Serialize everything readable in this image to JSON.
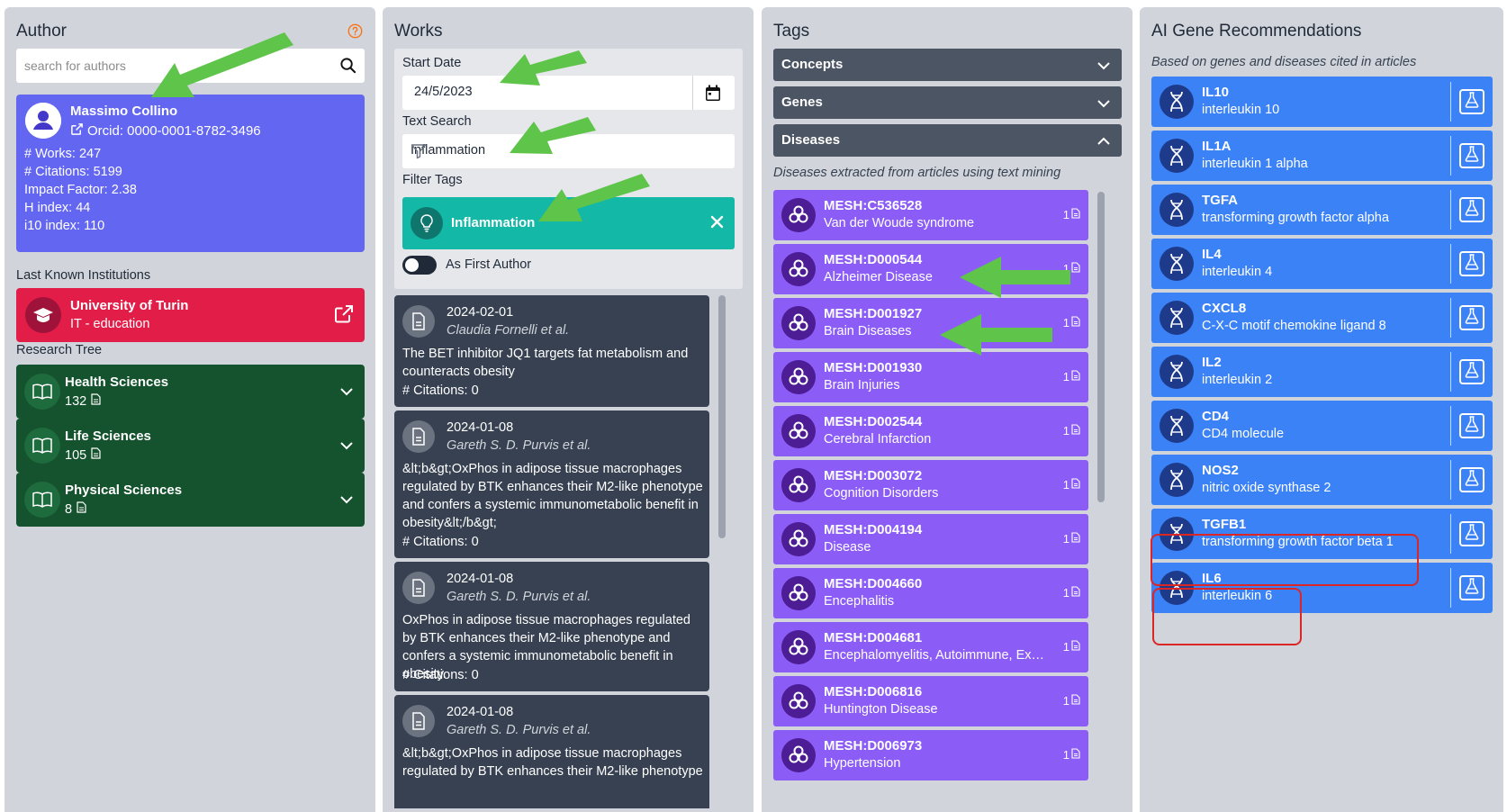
{
  "author_panel": {
    "title": "Author",
    "search_placeholder": "search for authors",
    "author": {
      "name": "Massimo Collino",
      "orcid": "Orcid: 0000-0001-8782-3496",
      "works": "# Works: 247",
      "citations": "# Citations: 5199",
      "impact": "Impact Factor: 2.38",
      "h_index": "H index: 44",
      "i10_index": "i10 index: 110"
    },
    "institutions_label": "Last Known Institutions",
    "institution": {
      "name": "University of Turin",
      "sub": "IT - education"
    },
    "tree_label": "Research Tree",
    "tree": [
      {
        "name": "Health Sciences",
        "count": "132"
      },
      {
        "name": "Life Sciences",
        "count": "105"
      },
      {
        "name": "Physical Sciences",
        "count": "8"
      }
    ]
  },
  "works_panel": {
    "title": "Works",
    "start_date_label": "Start Date",
    "start_date_value": "24/5/2023",
    "text_search_label": "Text Search",
    "text_search_value": "Inflammation",
    "filter_tags_label": "Filter Tags",
    "active_tag": "Inflammation",
    "first_author_label": "As First Author",
    "works": [
      {
        "date": "2024-02-01",
        "authors": "Claudia Fornelli et al.",
        "title": "The BET inhibitor JQ1 targets fat metabolism and counteracts obesity",
        "citations": "# Citations: 0"
      },
      {
        "date": "2024-01-08",
        "authors": "Gareth S. D. Purvis et al.",
        "title": "&lt;b&gt;OxPhos in adipose tissue macrophages regulated by BTK enhances their M2-like phenotype and confers a systemic immunometabolic benefit in obesity&lt;/b&gt;",
        "citations": "# Citations: 0"
      },
      {
        "date": "2024-01-08",
        "authors": "Gareth S. D. Purvis et al.",
        "title": "OxPhos in adipose tissue macrophages regulated by BTK enhances their M2-like phenotype and confers a systemic immunometabolic benefit in obesity.",
        "citations": "# Citations: 0"
      },
      {
        "date": "2024-01-08",
        "authors": "Gareth S. D. Purvis et al.",
        "title": "&lt;b&gt;OxPhos in adipose tissue macrophages regulated by BTK enhances their M2-like phenotype",
        "citations": ""
      }
    ]
  },
  "tags_panel": {
    "title": "Tags",
    "sections": [
      "Concepts",
      "Genes",
      "Diseases"
    ],
    "diseases_note": "Diseases extracted from articles using text mining",
    "diseases": [
      {
        "code": "MESH:C536528",
        "name": "Van der Woude syndrome",
        "count": "1"
      },
      {
        "code": "MESH:D000544",
        "name": "Alzheimer Disease",
        "count": "1"
      },
      {
        "code": "MESH:D001927",
        "name": "Brain Diseases",
        "count": "1"
      },
      {
        "code": "MESH:D001930",
        "name": "Brain Injuries",
        "count": "1"
      },
      {
        "code": "MESH:D002544",
        "name": "Cerebral Infarction",
        "count": "1"
      },
      {
        "code": "MESH:D003072",
        "name": "Cognition Disorders",
        "count": "1"
      },
      {
        "code": "MESH:D004194",
        "name": "Disease",
        "count": "1"
      },
      {
        "code": "MESH:D004660",
        "name": "Encephalitis",
        "count": "1"
      },
      {
        "code": "MESH:D004681",
        "name": "Encephalomyelitis, Autoimmune, Expe...",
        "count": "1"
      },
      {
        "code": "MESH:D006816",
        "name": "Huntington Disease",
        "count": "1"
      },
      {
        "code": "MESH:D006973",
        "name": "Hypertension",
        "count": "1"
      }
    ]
  },
  "genes_panel": {
    "title": "AI Gene Recommendations",
    "subtitle": "Based on genes and diseases cited in articles",
    "genes": [
      {
        "symbol": "IL10",
        "name": "interleukin 10"
      },
      {
        "symbol": "IL1A",
        "name": "interleukin 1 alpha"
      },
      {
        "symbol": "TGFA",
        "name": "transforming growth factor alpha"
      },
      {
        "symbol": "IL4",
        "name": "interleukin 4"
      },
      {
        "symbol": "CXCL8",
        "name": "C-X-C motif chemokine ligand 8"
      },
      {
        "symbol": "IL2",
        "name": "interleukin 2"
      },
      {
        "symbol": "CD4",
        "name": "CD4 molecule"
      },
      {
        "symbol": "NOS2",
        "name": "nitric oxide synthase 2"
      },
      {
        "symbol": "TGFB1",
        "name": "transforming growth factor beta 1"
      },
      {
        "symbol": "IL6",
        "name": "interleukin 6"
      }
    ]
  },
  "colors": {
    "author_card": "#6366f1",
    "institution": "#e11d48",
    "tree": "#14532d",
    "tag_chip": "#14b8a6",
    "work_card": "#374151",
    "disease_card": "#8b5cf6",
    "gene_card": "#3b82f6",
    "annotation_arrow": "#5fc44a",
    "annotation_box": "#dc2626"
  }
}
